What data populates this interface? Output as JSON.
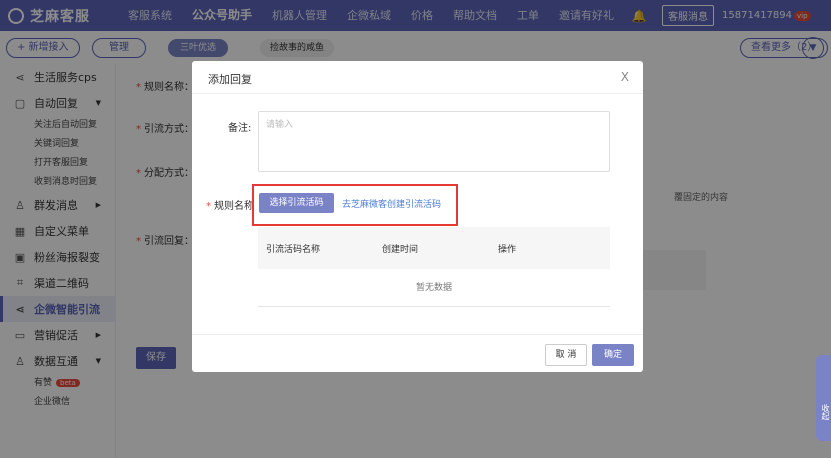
{
  "topnav": {
    "logo": "芝麻客服",
    "items": [
      "客服系统",
      "公众号助手",
      "机器人管理",
      "企微私域",
      "价格",
      "帮助文档",
      "工单",
      "邀请有好礼"
    ],
    "active_index": 1,
    "message_btn": "客服消息",
    "phone": "15871417894",
    "vip": "vip"
  },
  "toolbar": {
    "new_btn": "+ 新增接入",
    "manage_btn": "管理",
    "active_account": "三叶优选",
    "other_account": "捡故事的咸鱼",
    "more_btn": "查看更多（2）"
  },
  "sidebar": {
    "items": [
      {
        "label": "生活服务cps",
        "icon": "share-icon"
      },
      {
        "label": "自动回复",
        "icon": "message-icon",
        "arrow": "▼"
      },
      {
        "label": "关注后自动回复",
        "sub": true
      },
      {
        "label": "关键词回复",
        "sub": true
      },
      {
        "label": "打开客服回复",
        "sub": true
      },
      {
        "label": "收到消息时回复",
        "sub": true
      },
      {
        "label": "群发消息",
        "icon": "users-icon",
        "arrow": "▶"
      },
      {
        "label": "自定义菜单",
        "icon": "grid-icon"
      },
      {
        "label": "粉丝海报裂变",
        "icon": "image-icon"
      },
      {
        "label": "渠道二维码",
        "icon": "qrcode-icon"
      },
      {
        "label": "企微智能引流",
        "icon": "share-icon",
        "active": true
      },
      {
        "label": "营销促活",
        "icon": "monitor-icon",
        "arrow": "▶"
      },
      {
        "label": "数据互通",
        "icon": "user-icon",
        "arrow": "▼"
      },
      {
        "label": "有赞",
        "sub": true,
        "badge": "beta"
      },
      {
        "label": "企业微信",
        "sub": true
      }
    ]
  },
  "main": {
    "rule_name_label": "规则名称：",
    "traffic_mode_label": "引流方式：",
    "assign_mode_label": "分配方式：",
    "traffic_reply_label": "引流回复：",
    "side_text": "覆固定的内容",
    "save_btn": "保存"
  },
  "modal": {
    "title": "添加回复",
    "close": "X",
    "remark_label": "备注:",
    "remark_placeholder": "请输入",
    "rule_label": "规则名称",
    "select_btn": "选择引流活码",
    "create_link": "去芝麻微客创建引流活码",
    "table_headers": [
      "引流活码名称",
      "创建时间",
      "操作"
    ],
    "empty_text": "暂无数据",
    "cancel_btn": "取 消",
    "ok_btn": "确定"
  },
  "side_tab": "收起"
}
